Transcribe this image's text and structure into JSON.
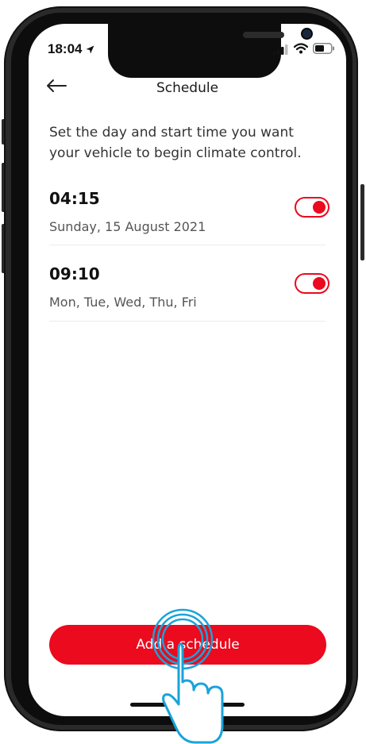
{
  "status_bar": {
    "time": "18:04",
    "icons": [
      "location-arrow-icon",
      "signal-icon",
      "wifi-icon",
      "battery-icon"
    ]
  },
  "nav": {
    "title": "Schedule",
    "back_icon": "back-arrow-icon"
  },
  "description": "Set the day and start time you want your vehicle to begin climate control.",
  "schedules": [
    {
      "time": "04:15",
      "days": "Sunday, 15 August 2021",
      "enabled": true
    },
    {
      "time": "09:10",
      "days": "Mon, Tue, Wed, Thu, Fri",
      "enabled": true
    }
  ],
  "add_button": {
    "label": "Add a schedule"
  },
  "colors": {
    "accent": "#eb0a1e",
    "tap_ring": "#1aa3d9"
  }
}
